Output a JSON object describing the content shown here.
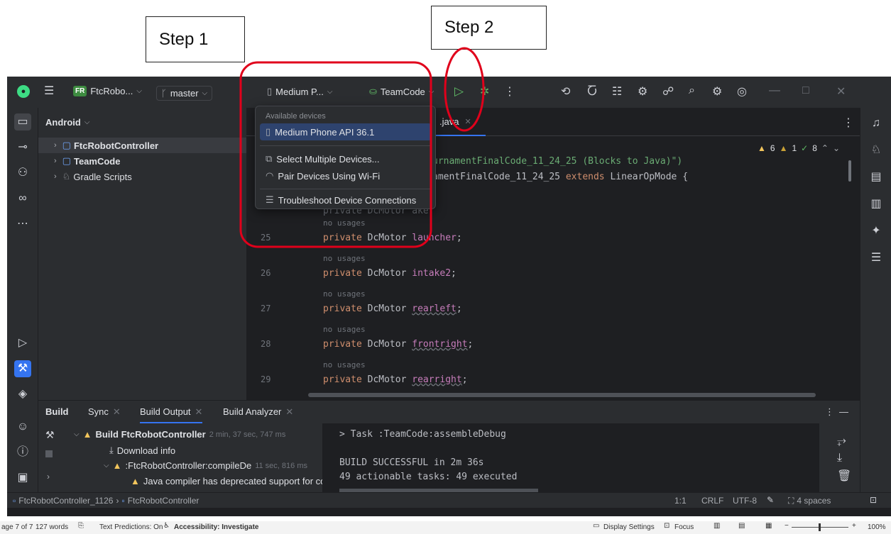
{
  "annotations": {
    "step1": "Step 1",
    "step2": "Step 2"
  },
  "titlebar": {
    "project_badge": "FR",
    "project_name": "FtcRobo...",
    "branch": "master",
    "device": "Medium P...",
    "run_config": "TeamCode"
  },
  "project_panel": {
    "header": "Android",
    "items": [
      {
        "label": "FtcRobotController"
      },
      {
        "label": "TeamCode"
      },
      {
        "label": "Gradle Scripts"
      }
    ]
  },
  "device_menu": {
    "header": "Available devices",
    "selected_device": "Medium Phone API 36.1",
    "select_multiple": "Select Multiple Devices...",
    "pair_wifi": "Pair Devices Using Wi-Fi",
    "troubleshoot": "Troubleshoot Device Connections"
  },
  "editor": {
    "tab_label": ".java",
    "inspection_counts": {
      "warnings": "6",
      "weak_warnings": "1",
      "ok": "8"
    },
    "line1_tail": "urnamentFinalCode_11_24_25 (Blocks to Java)\")",
    "line2_tail_a": "amentFinalCode_11_24_25 ",
    "line2_kw": "extends",
    "line2_tail_b": " LinearOpMode {",
    "partial_line_a": "private DcMotor ",
    "partial_line_b": "ake;",
    "usage_hint": "no usages",
    "lines": [
      {
        "num": "25",
        "kw": "private",
        "type": "DcMotor",
        "name": "launcher"
      },
      {
        "num": "26",
        "kw": "private",
        "type": "DcMotor",
        "name": "intake2"
      },
      {
        "num": "27",
        "kw": "private",
        "type": "DcMotor",
        "name": "rearleft"
      },
      {
        "num": "28",
        "kw": "private",
        "type": "DcMotor",
        "name": "frontright"
      },
      {
        "num": "29",
        "kw": "private",
        "type": "DcMotor",
        "name": "rearright"
      }
    ]
  },
  "build": {
    "tabs": [
      "Build",
      "Sync",
      "Build Output",
      "Build Analyzer"
    ],
    "tree": {
      "root_label": "Build FtcRobotController",
      "root_time": "2 min, 37 sec, 747 ms",
      "download": "Download info",
      "compile_label": ":FtcRobotController:compileDe",
      "compile_time": "11 sec, 816 ms",
      "warning": "Java compiler has deprecated support for con"
    },
    "console": {
      "task": "> Task :TeamCode:assembleDebug",
      "result": "BUILD SUCCESSFUL in 2m 36s",
      "summary": "49 actionable tasks: 49 executed"
    }
  },
  "status_bar": {
    "breadcrumb_project": "FtcRobotController_1126",
    "breadcrumb_module": "FtcRobotController",
    "position": "1:1",
    "line_ending": "CRLF",
    "encoding": "UTF-8",
    "indent": "4 spaces"
  },
  "word_status": {
    "page": "age 7 of 7",
    "words": "127 words",
    "text_predictions": "Text Predictions: On",
    "accessibility": "Accessibility: Investigate",
    "display_settings": "Display Settings",
    "focus": "Focus",
    "zoom": "100%"
  },
  "colors": {
    "ide_bg": "#1e1f22",
    "panel_bg": "#2b2d30",
    "accent_blue": "#3574f0",
    "run_green": "#5fb865",
    "warning_yellow": "#f2c55c",
    "annotation_red": "#e0001b"
  }
}
